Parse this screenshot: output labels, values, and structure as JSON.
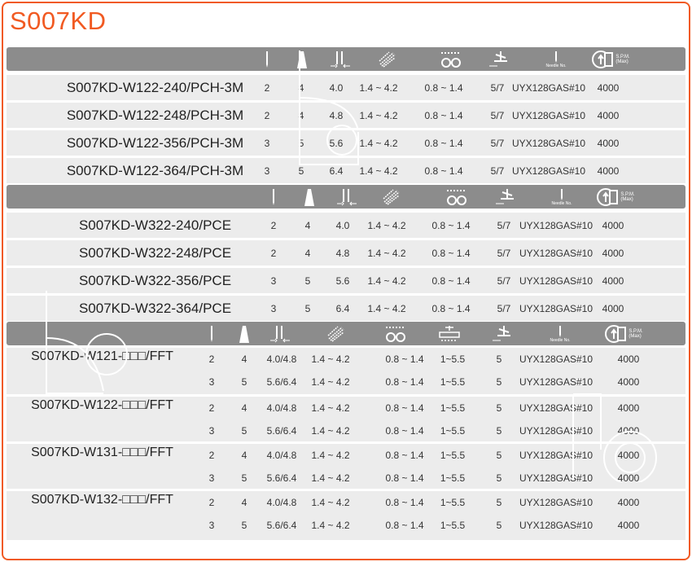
{
  "title": "S007KD",
  "colors": {
    "accent": "#f15a22",
    "header": "#8c8c8c",
    "row": "#ececec"
  },
  "header_labels": {
    "needle_no": "Needle No.",
    "spm": "S.P.M.",
    "spm_max": "(Max)",
    "mm": "mm"
  },
  "table1": {
    "rows": [
      {
        "model": "S007KD-W122-240/PCH-3M",
        "needles": "2",
        "threads": "4",
        "gauge": "4.0",
        "stitch": "1.4 ~ 4.2",
        "diff": "0.8 ~ 1.4",
        "foot": "5/7",
        "needle": "UYX128GAS#10",
        "spm": "4000"
      },
      {
        "model": "S007KD-W122-248/PCH-3M",
        "needles": "2",
        "threads": "4",
        "gauge": "4.8",
        "stitch": "1.4 ~ 4.2",
        "diff": "0.8 ~ 1.4",
        "foot": "5/7",
        "needle": "UYX128GAS#10",
        "spm": "4000"
      },
      {
        "model": "S007KD-W122-356/PCH-3M",
        "needles": "3",
        "threads": "5",
        "gauge": "5.6",
        "stitch": "1.4 ~ 4.2",
        "diff": "0.8 ~ 1.4",
        "foot": "5/7",
        "needle": "UYX128GAS#10",
        "spm": "4000"
      },
      {
        "model": "S007KD-W122-364/PCH-3M",
        "needles": "3",
        "threads": "5",
        "gauge": "6.4",
        "stitch": "1.4 ~ 4.2",
        "diff": "0.8 ~ 1.4",
        "foot": "5/7",
        "needle": "UYX128GAS#10",
        "spm": "4000"
      }
    ]
  },
  "table2": {
    "rows": [
      {
        "model": "S007KD-W322-240/PCE",
        "needles": "2",
        "threads": "4",
        "gauge": "4.0",
        "stitch": "1.4 ~ 4.2",
        "diff": "0.8 ~ 1.4",
        "foot": "5/7",
        "needle": "UYX128GAS#10",
        "spm": "4000"
      },
      {
        "model": "S007KD-W322-248/PCE",
        "needles": "2",
        "threads": "4",
        "gauge": "4.8",
        "stitch": "1.4 ~ 4.2",
        "diff": "0.8 ~ 1.4",
        "foot": "5/7",
        "needle": "UYX128GAS#10",
        "spm": "4000"
      },
      {
        "model": "S007KD-W322-356/PCE",
        "needles": "3",
        "threads": "5",
        "gauge": "5.6",
        "stitch": "1.4 ~ 4.2",
        "diff": "0.8 ~ 1.4",
        "foot": "5/7",
        "needle": "UYX128GAS#10",
        "spm": "4000"
      },
      {
        "model": "S007KD-W322-364/PCE",
        "needles": "3",
        "threads": "5",
        "gauge": "6.4",
        "stitch": "1.4 ~ 4.2",
        "diff": "0.8 ~ 1.4",
        "foot": "5/7",
        "needle": "UYX128GAS#10",
        "spm": "4000"
      }
    ]
  },
  "table3": {
    "groups": [
      {
        "model": "S007KD-W121-□□□/FFT",
        "lines": [
          {
            "needles": "2",
            "threads": "4",
            "gauge": "4.0/4.8",
            "stitch": "1.4 ~ 4.2",
            "diff": "0.8 ~ 1.4",
            "top": "1~5.5",
            "foot": "5",
            "needle": "UYX128GAS#10",
            "spm": "4000"
          },
          {
            "needles": "3",
            "threads": "5",
            "gauge": "5.6/6.4",
            "stitch": "1.4 ~ 4.2",
            "diff": "0.8 ~ 1.4",
            "top": "1~5.5",
            "foot": "5",
            "needle": "UYX128GAS#10",
            "spm": "4000"
          }
        ]
      },
      {
        "model": "S007KD-W122-□□□/FFT",
        "lines": [
          {
            "needles": "2",
            "threads": "4",
            "gauge": "4.0/4.8",
            "stitch": "1.4 ~ 4.2",
            "diff": "0.8 ~ 1.4",
            "top": "1~5.5",
            "foot": "5",
            "needle": "UYX128GAS#10",
            "spm": "4000"
          },
          {
            "needles": "3",
            "threads": "5",
            "gauge": "5.6/6.4",
            "stitch": "1.4 ~ 4.2",
            "diff": "0.8 ~ 1.4",
            "top": "1~5.5",
            "foot": "5",
            "needle": "UYX128GAS#10",
            "spm": "4000"
          }
        ]
      },
      {
        "model": "S007KD-W131-□□□/FFT",
        "lines": [
          {
            "needles": "2",
            "threads": "4",
            "gauge": "4.0/4.8",
            "stitch": "1.4 ~ 4.2",
            "diff": "0.8 ~ 1.4",
            "top": "1~5.5",
            "foot": "5",
            "needle": "UYX128GAS#10",
            "spm": "4000"
          },
          {
            "needles": "3",
            "threads": "5",
            "gauge": "5.6/6.4",
            "stitch": "1.4 ~ 4.2",
            "diff": "0.8 ~ 1.4",
            "top": "1~5.5",
            "foot": "5",
            "needle": "UYX128GAS#10",
            "spm": "4000"
          }
        ]
      },
      {
        "model": "S007KD-W132-□□□/FFT",
        "lines": [
          {
            "needles": "2",
            "threads": "4",
            "gauge": "4.0/4.8",
            "stitch": "1.4 ~ 4.2",
            "diff": "0.8 ~ 1.4",
            "top": "1~5.5",
            "foot": "5",
            "needle": "UYX128GAS#10",
            "spm": "4000"
          },
          {
            "needles": "3",
            "threads": "5",
            "gauge": "5.6/6.4",
            "stitch": "1.4 ~ 4.2",
            "diff": "0.8 ~ 1.4",
            "top": "1~5.5",
            "foot": "5",
            "needle": "UYX128GAS#10",
            "spm": "4000"
          }
        ]
      }
    ]
  }
}
